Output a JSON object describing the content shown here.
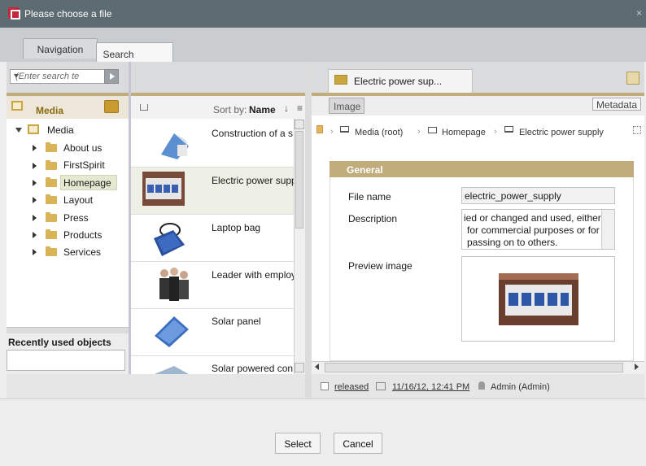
{
  "window": {
    "title": "Please choose a file",
    "close": "×"
  },
  "tabs": [
    {
      "label": "Navigation"
    },
    {
      "label": "Search"
    }
  ],
  "left": {
    "search_placeholder": "(Enter search te",
    "header": "Media",
    "tree": {
      "root": "Media",
      "items": [
        "About us",
        "FirstSpirit",
        "Homepage",
        "Layout",
        "Press",
        "Products",
        "Services"
      ],
      "selected": "Homepage"
    },
    "recent": "Recently used objects"
  },
  "middle": {
    "sort_label": "Sort by:",
    "sort_value": "Name",
    "items": [
      {
        "title": "Construction of a s"
      },
      {
        "title": "Electric power supp"
      },
      {
        "title": "Laptop bag"
      },
      {
        "title": "Leader with employ"
      },
      {
        "title": "Solar panel"
      },
      {
        "title": "Solar powered con"
      }
    ]
  },
  "right": {
    "doc_tab": "Electric power sup...",
    "image_tab": "Image",
    "metadata_tab": "Metadata",
    "breadcrumb": [
      "Media (root)",
      "Homepage",
      "Electric power supply"
    ],
    "section": "General",
    "file_name_label": "File name",
    "file_name_value": "electric_power_supply",
    "description_label": "Description",
    "description_lines": [
      "ied or changed and used, either",
      "for commercial purposes or for",
      "passing on to others."
    ],
    "preview_label": "Preview image",
    "status": {
      "released": "released",
      "date": "11/16/12, 12:41 PM",
      "user": "Admin (Admin)"
    }
  },
  "footer": {
    "select": "Select",
    "cancel": "Cancel"
  },
  "colors": {
    "accent": "#c1ac7b",
    "titlebar": "#5d6b72",
    "selection": "#e4e9d0"
  }
}
